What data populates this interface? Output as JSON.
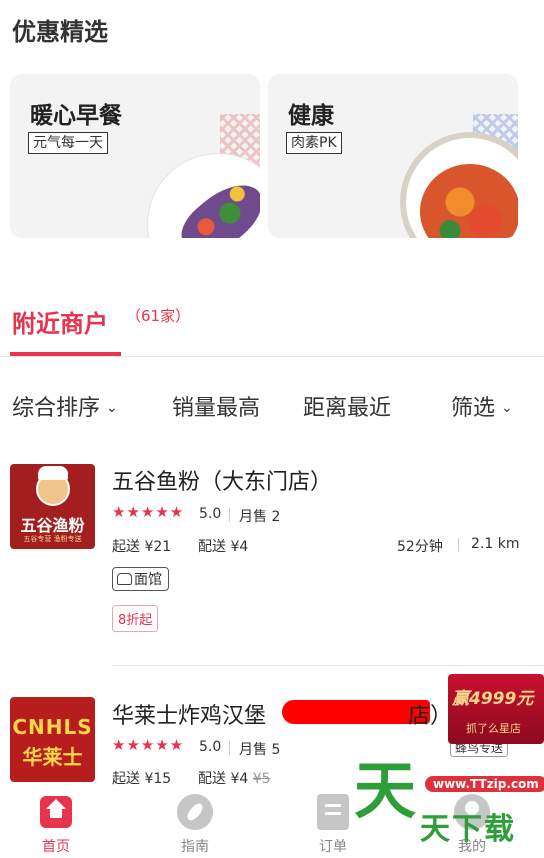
{
  "featured": {
    "title": "优惠精选",
    "cards": [
      {
        "title": "暖心早餐",
        "tag": "元气每一天"
      },
      {
        "title": "健康",
        "tag": "肉素PK"
      }
    ]
  },
  "nearby": {
    "title": "附近商户",
    "count": "（61家）"
  },
  "sort_bar": {
    "comprehensive": "综合排序",
    "sales": "销量最高",
    "distance": "距离最近",
    "filter": "筛选"
  },
  "stores": [
    {
      "name": "五谷鱼粉（大东门店）",
      "logo_text": "五谷渔粉",
      "logo_small": "五谷专营 渔粉专送",
      "stars": "★★★★★",
      "rating": "5.0",
      "monthly_sales": "月售 2",
      "min_order": "起送 ¥21",
      "delivery_fee": "配送 ¥4",
      "time": "52分钟",
      "distance": "2.1 km",
      "category": "面馆",
      "discount": "8折起"
    },
    {
      "name": "华莱士炸鸡汉堡",
      "name_tail": "店）",
      "logo_top": "CNHLS",
      "logo_bottom": "华莱士",
      "stars": "★★★★★",
      "rating": "5.0",
      "monthly_sales": "月售 5",
      "min_order": "起送 ¥15",
      "delivery_fee": "配送 ¥4",
      "delivery_original": "¥5",
      "delivery_badge": "蜂鸟专送"
    }
  ],
  "ad": {
    "main": "赢4999元",
    "sub": "抓了么星店"
  },
  "tabbar": {
    "home": "首页",
    "guide": "指南",
    "orders": "订单",
    "me": "我的"
  },
  "watermark": {
    "url": "www.TTzip.com",
    "big": "天",
    "small": "天下载"
  },
  "colors": {
    "accent": "#e8334f",
    "watermark_green": "#2e9e3a"
  }
}
